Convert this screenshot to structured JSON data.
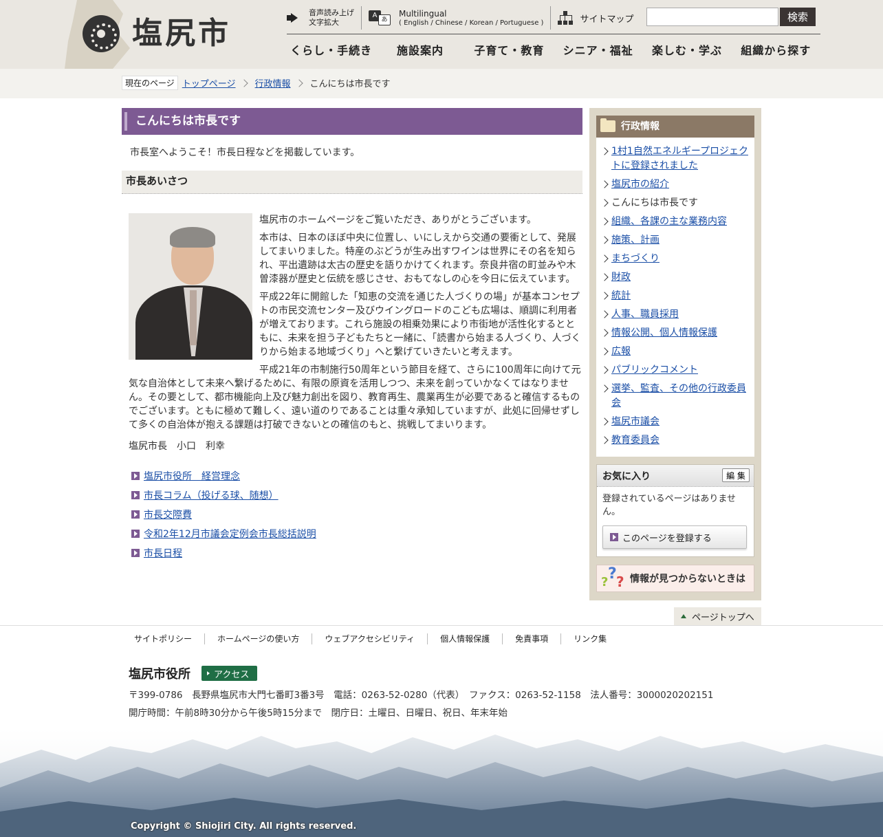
{
  "header": {
    "logo_text": "塩尻市",
    "utility": {
      "voice_line1": "音声読み上げ",
      "voice_line2": "文字拡大",
      "multilingual_title": "Multilingual",
      "multilingual_sub": "( English / Chinese / Korean / Portuguese )",
      "sitemap_label": "サイトマップ"
    },
    "search": {
      "placeholder": "",
      "button_label": "検索"
    },
    "global_nav": [
      "くらし・手続き",
      "施設案内",
      "子育て・教育",
      "シニア・福祉",
      "楽しむ・学ぶ",
      "組織から探す"
    ]
  },
  "breadcrumb": {
    "label": "現在のページ",
    "items": [
      "トップページ",
      "行政情報"
    ],
    "current": "こんにちは市長です"
  },
  "main": {
    "title": "こんにちは市長です",
    "lead": "市長室へようこそ！市長日程などを掲載しています。",
    "section_heading": "市長あいさつ",
    "paragraphs": [
      "塩尻市のホームページをご覧いただき、ありがとうございます。",
      "本市は、日本のほぼ中央に位置し、いにしえから交通の要衝として、発展してまいりました。特産のぶどうが生み出すワインは世界にその名を知られ、平出遺跡は太古の歴史を語りかけてくれます。奈良井宿の町並みや木曽漆器が歴史と伝統を感じさせ、おもてなしの心を今日に伝えています。",
      "平成22年に開館した「知恵の交流を通じた人づくりの場」が基本コンセプトの市民交流センター及びウイングロードのこども広場は、順調に利用者が増えております。これら施設の相乗効果により市街地が活性化するとともに、未来を担う子どもたちと一緒に、「読書から始まる人づくり、人づくりから始まる地域づくり」へと繋げていきたいと考えます。",
      "平成21年の市制施行50周年という節目を経て、さらに100周年に向けて元気な自治体として未来へ繋げるために、有限の原資を活用しつつ、未来を創っていかなくてはなりません。その要として、都市機能向上及び魅力創出を図り、教育再生、農業再生が必要であると確信するものでございます。ともに極めて難しく、遠い道のりであることは重々承知していますが、此処に回帰せずして多くの自治体が抱える課題は打破できないとの確信のもと、挑戦してまいります。"
    ],
    "signature": "塩尻市長　小口　利幸",
    "links": [
      "塩尻市役所　経営理念",
      "市長コラム（投げる球、随想）",
      "市長交際費",
      "令和2年12月市議会定例会市長総括説明",
      "市長日程"
    ]
  },
  "sidebar": {
    "nav_title": "行政情報",
    "items": [
      {
        "label": "1村1自然エネルギープロジェクトに登録されました",
        "link": true
      },
      {
        "label": "塩尻市の紹介",
        "link": true
      },
      {
        "label": "こんにちは市長です",
        "link": false
      },
      {
        "label": "組織、各課の主な業務内容",
        "link": true
      },
      {
        "label": "施策、計画",
        "link": true
      },
      {
        "label": "まちづくり",
        "link": true
      },
      {
        "label": "財政",
        "link": true
      },
      {
        "label": "統計",
        "link": true
      },
      {
        "label": "人事、職員採用",
        "link": true
      },
      {
        "label": "情報公開、個人情報保護",
        "link": true
      },
      {
        "label": "広報",
        "link": true
      },
      {
        "label": "パブリックコメント",
        "link": true
      },
      {
        "label": "選挙、監査、その他の行政委員会",
        "link": true
      },
      {
        "label": "塩尻市議会",
        "link": true
      },
      {
        "label": "教育委員会",
        "link": true
      }
    ],
    "favorites": {
      "title": "お気に入り",
      "edit_label": "編 集",
      "message": "登録されているページはありません。",
      "register_label": "このページを登録する"
    },
    "help_label": "情報が見つからないときは"
  },
  "pagetop_label": "ページトップへ",
  "footer": {
    "links": [
      "サイトポリシー",
      "ホームページの使い方",
      "ウェブアクセシビリティ",
      "個人情報保護",
      "免責事項",
      "リンク集"
    ],
    "office_name": "塩尻市役所",
    "access_label": "アクセス",
    "address": "〒399-0786　長野県塩尻市大門七番町3番3号　電話：0263-52-0280（代表）　ファクス：0263-52-1158　法人番号：3000020202151",
    "hours": "開庁時間：午前8時30分から午後5時15分まで　閉庁日：土曜日、日曜日、祝日、年末年始",
    "copyright": "Copyright © Shiojiri City. All rights reserved."
  },
  "colors": {
    "accent_purple": "#7d5a93",
    "sidebar_brown": "#8b7966",
    "access_green": "#1f6e45",
    "link_blue": "#1a4ea6"
  },
  "icons": [
    "speaker-icon",
    "multilingual-icon",
    "sitemap-icon",
    "folder-icon",
    "question-icon",
    "page-top-arrow-icon"
  ]
}
